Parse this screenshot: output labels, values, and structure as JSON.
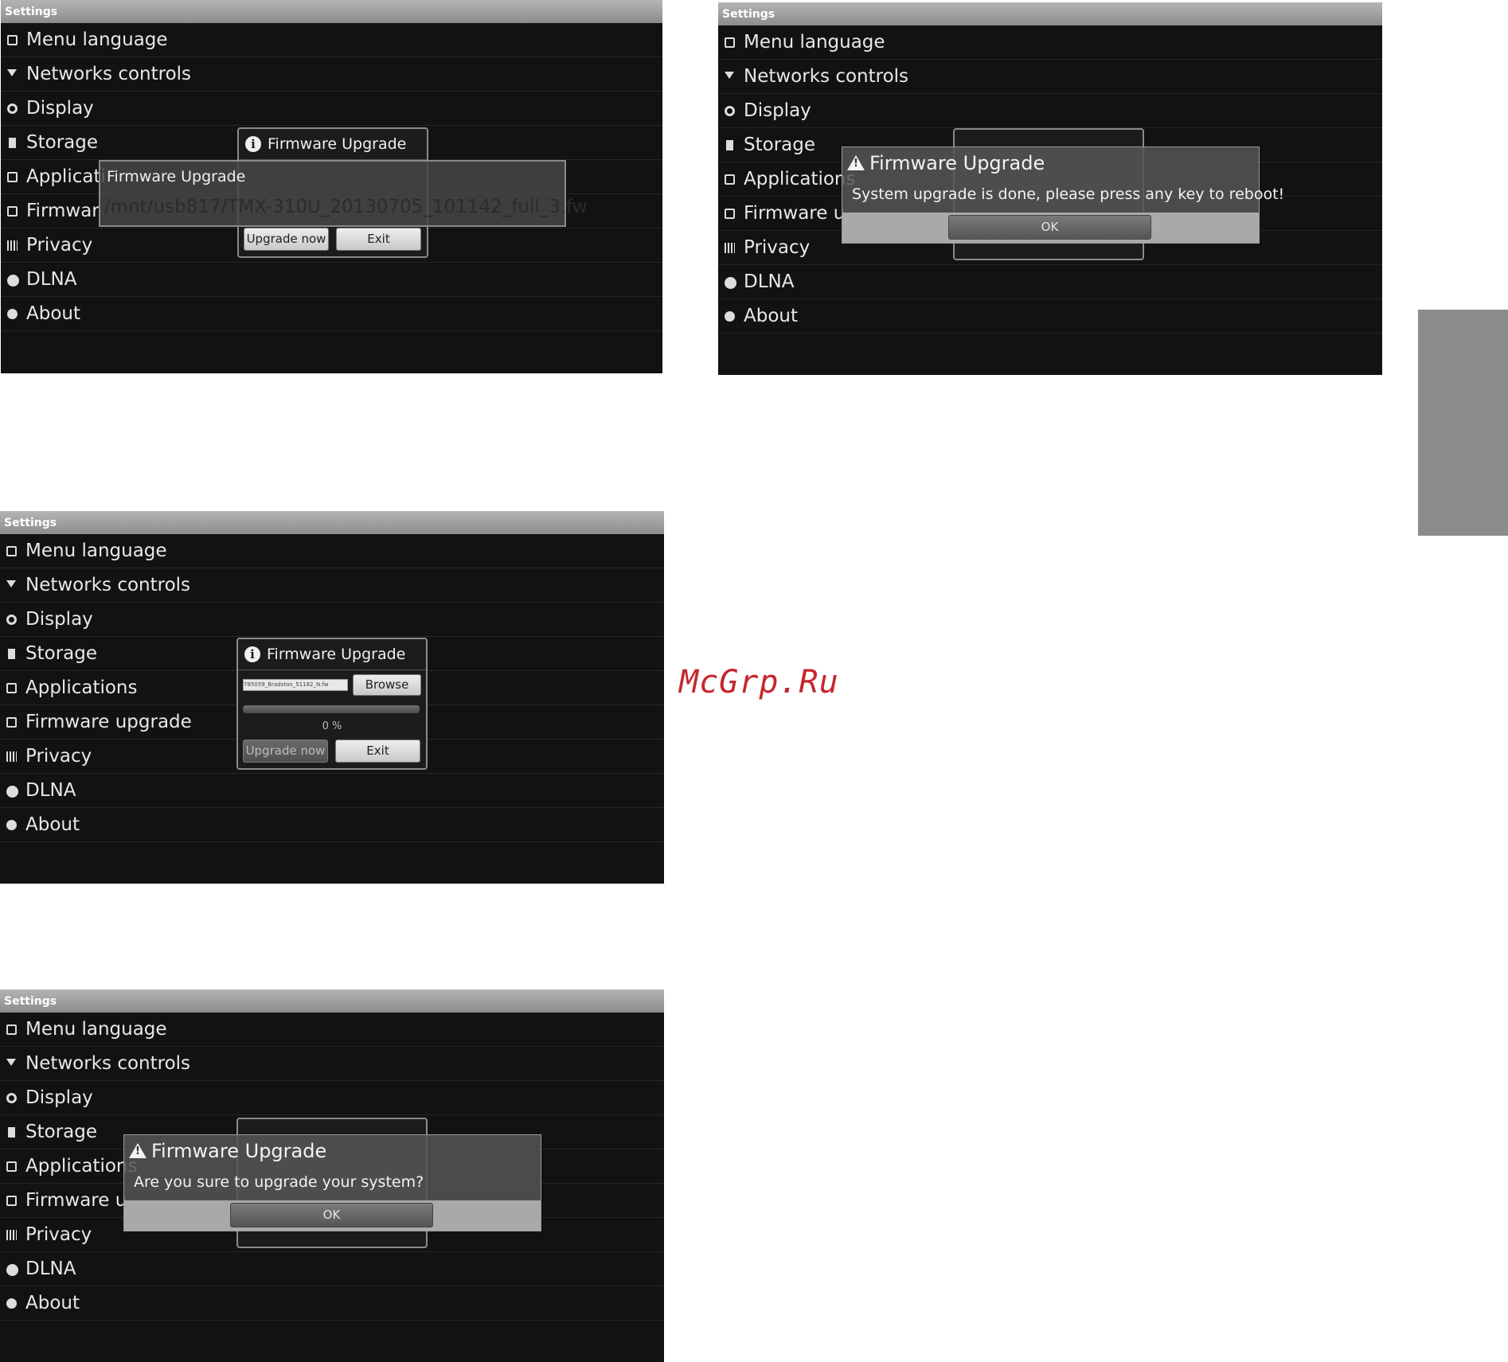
{
  "settings_title": "Settings",
  "menu": {
    "menu_language": "Menu language",
    "networks_controls": "Networks controls",
    "display": "Display",
    "storage": "Storage",
    "applications": "Applications",
    "firmware_upgrade": "Firmware upgrade",
    "privacy": "Privacy",
    "dlna": "DLNA",
    "about": "About",
    "applications_cut": "Applicati",
    "firmware_cut": "Firmwar",
    "firmware_cut2": "Firmware u"
  },
  "dialog": {
    "title": "Firmware Upgrade",
    "browse": "Browse",
    "upgrade_now": "Upgrade now",
    "exit": "Exit",
    "file_name": "785059_Bradston_51182_N.fw",
    "progress_percent": 0,
    "progress_text": "0 %"
  },
  "screen1": {
    "toast_title": "Firmware Upgrade",
    "toast_path": "/mnt/usb817/TMX-310U_20130705_101142_full_3.fw"
  },
  "screen2": {
    "overlay_title": "Firmware Upgrade",
    "overlay_message": "System upgrade is done, please press any key to reboot!",
    "ok": "OK"
  },
  "screen4": {
    "overlay_title": "Firmware Upgrade",
    "overlay_message": "Are you sure to upgrade your system?",
    "ok": "OK"
  },
  "watermark": "McGrp.Ru",
  "colors": {
    "background": "#121212",
    "titlebar": "#9e9e9e",
    "watermark": "#c6262e",
    "side_tab": "#8c8c8c"
  },
  "icons": [
    "language-icon",
    "network-icon",
    "display-icon",
    "storage-icon",
    "applications-icon",
    "firmware-icon",
    "privacy-icon",
    "dlna-icon",
    "about-icon",
    "info-icon",
    "warning-icon"
  ]
}
